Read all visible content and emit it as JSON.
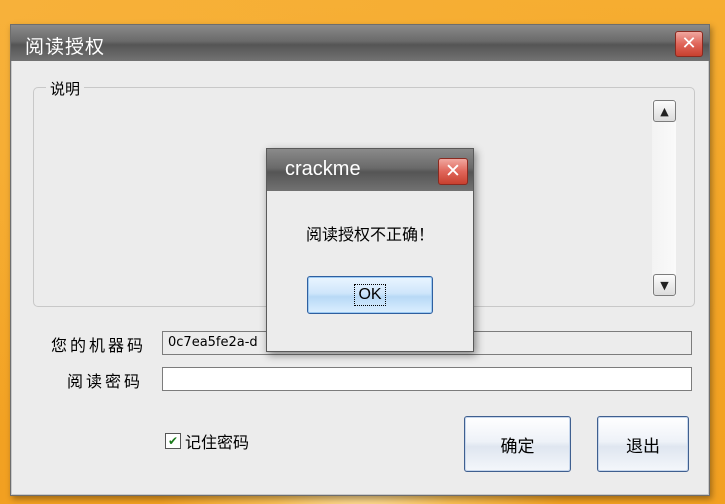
{
  "main_window": {
    "title": "阅读授权",
    "close_glyph": "✕",
    "groupbox_label": "说明",
    "scroll_up_glyph": "▲",
    "scroll_down_glyph": "▼",
    "machine_code_label": "您的机器码",
    "machine_code_value": "0c7ea5fe2a-d",
    "password_label": "阅读密码",
    "password_value": "",
    "remember_checked_glyph": "✔",
    "remember_label": "记住密码",
    "ok_button_label": "确定",
    "exit_button_label": "退出"
  },
  "dialog": {
    "title": "crackme",
    "close_glyph": "✕",
    "message": "阅读授权不正确！",
    "ok_label": "OK"
  },
  "colors": {
    "desktop": "#f4a62a",
    "titlebar": "#6a6a6a",
    "close_red": "#e0665a"
  }
}
